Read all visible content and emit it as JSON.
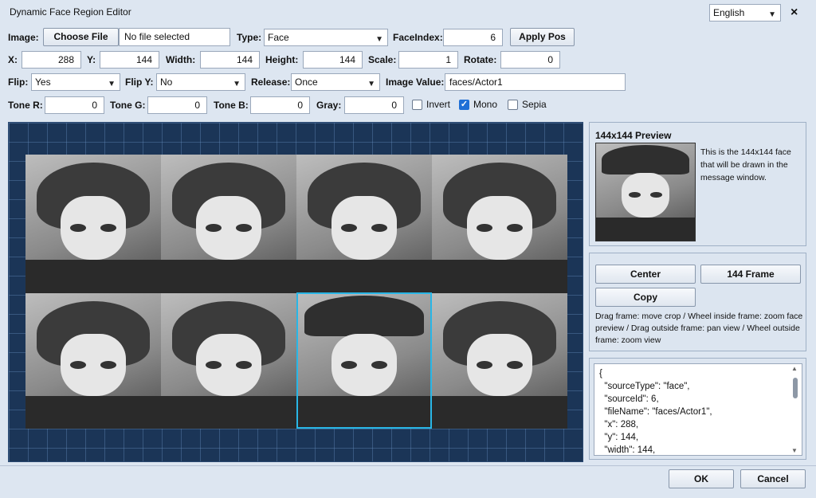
{
  "window": {
    "title": "Dynamic Face Region Editor",
    "language": "English",
    "close_glyph": "×"
  },
  "row1": {
    "image_label": "Image:",
    "choose_file": "Choose File",
    "file_status": "No file selected",
    "type_label": "Type:",
    "type_value": "Face",
    "face_index_label": "FaceIndex:",
    "face_index_value": "6",
    "apply_pos": "Apply Pos"
  },
  "row2": {
    "x_label": "X:",
    "x_value": "288",
    "y_label": "Y:",
    "y_value": "144",
    "width_label": "Width:",
    "width_value": "144",
    "height_label": "Height:",
    "height_value": "144",
    "scale_label": "Scale:",
    "scale_value": "1",
    "rotate_label": "Rotate:",
    "rotate_value": "0"
  },
  "row3": {
    "flip_label": "Flip:",
    "flip_value": "Yes",
    "flip_y_label": "Flip Y:",
    "flip_y_value": "No",
    "release_label": "Release:",
    "release_value": "Once",
    "image_value_label": "Image Value:",
    "image_value": "faces/Actor1"
  },
  "row4": {
    "tone_r_label": "Tone R:",
    "tone_r_value": "0",
    "tone_g_label": "Tone G:",
    "tone_g_value": "0",
    "tone_b_label": "Tone B:",
    "tone_b_value": "0",
    "gray_label": "Gray:",
    "gray_value": "0",
    "invert_label": "Invert",
    "invert_checked": false,
    "mono_label": "Mono",
    "mono_checked": true,
    "sepia_label": "Sepia",
    "sepia_checked": false
  },
  "preview": {
    "title": "144x144 Preview",
    "description": "This is the 144x144 face that will be drawn in the message window."
  },
  "actions": {
    "center": "Center",
    "frame_144": "144 Frame",
    "copy": "Copy",
    "help": "Drag frame: move crop / Wheel inside frame: zoom face preview / Drag outside frame: pan view / Wheel outside frame: zoom view"
  },
  "json_output": "{\n  \"sourceType\": \"face\",\n  \"sourceId\": 6,\n  \"fileName\": \"faces/Actor1\",\n  \"x\": 288,\n  \"y\": 144,\n  \"width\": 144,",
  "footer": {
    "ok": "OK",
    "cancel": "Cancel"
  },
  "colors": {
    "accent": "#29b6e6",
    "canvas_bg": "#1b3557",
    "checkbox_on": "#1f6fd6"
  }
}
